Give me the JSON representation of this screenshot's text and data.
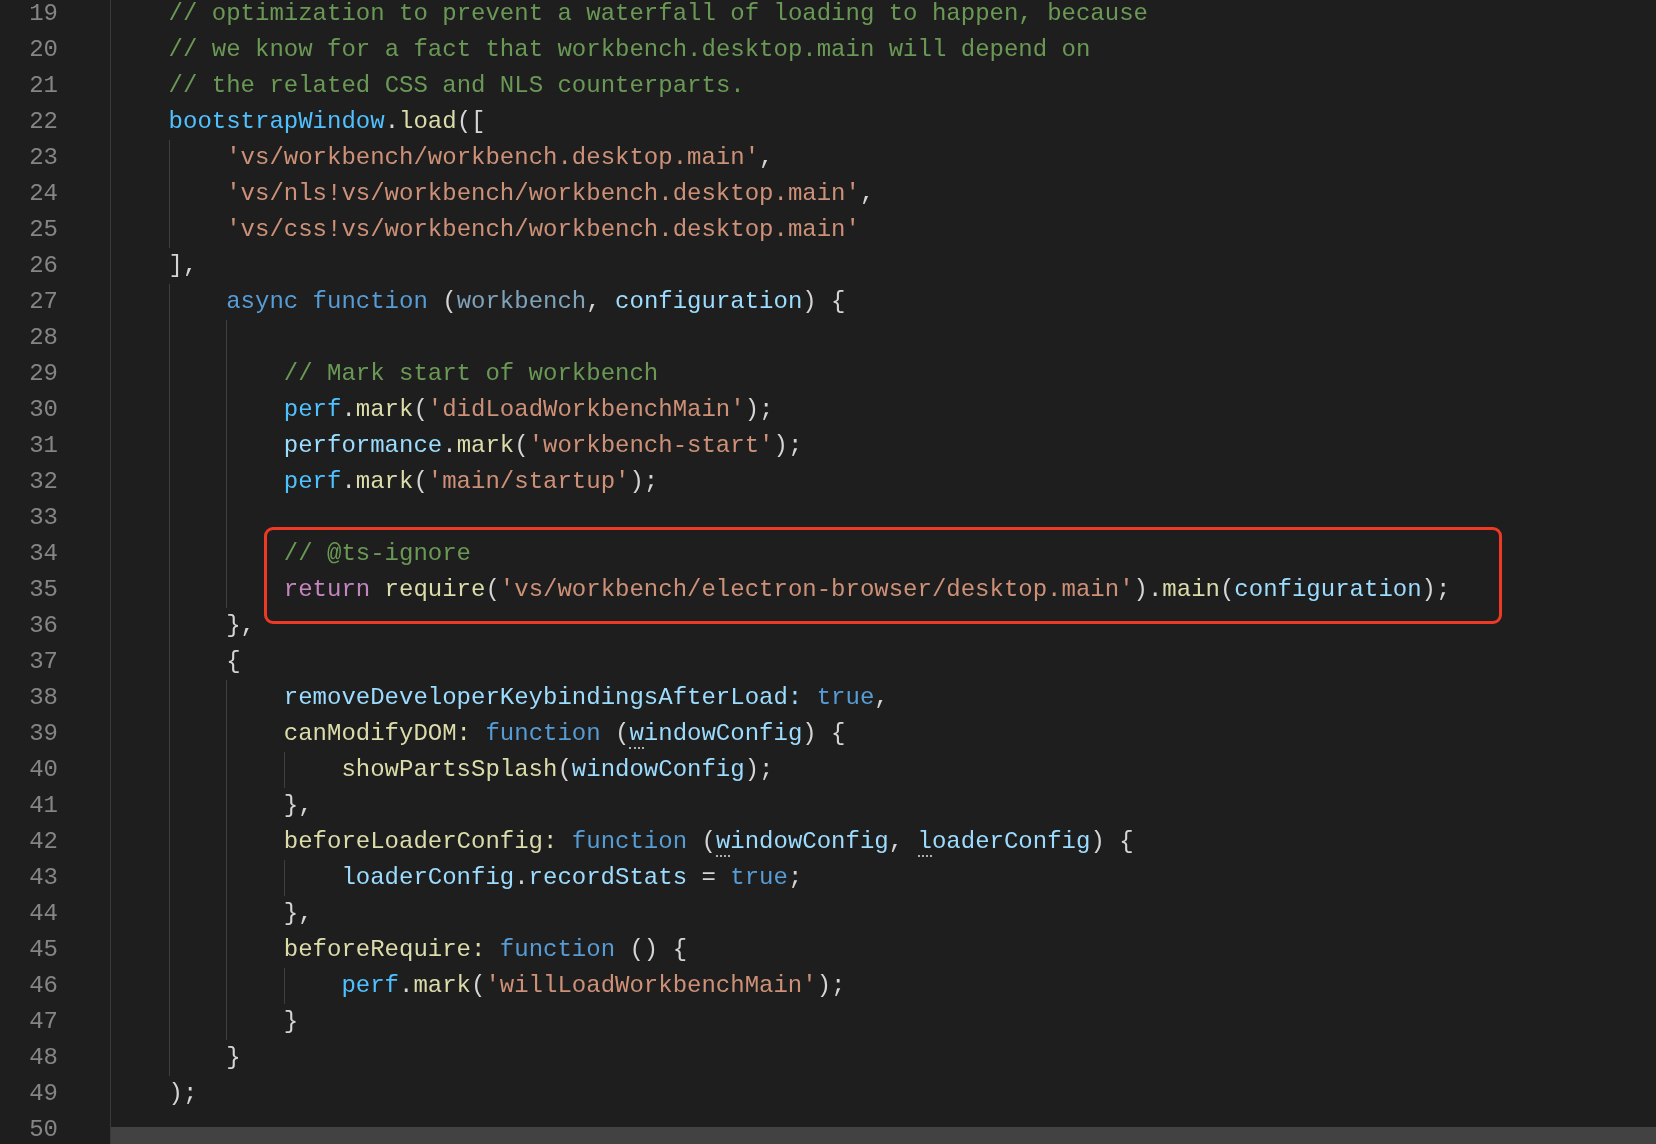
{
  "editor": {
    "lines": [
      {
        "number": "19",
        "tokens": [
          {
            "text": "// optimization to prevent a waterfall of loading to happen, because",
            "kind": "comment"
          }
        ]
      },
      {
        "number": "20",
        "tokens": [
          {
            "text": "// we know for a fact that workbench.desktop.main will depend on",
            "kind": "comment"
          }
        ]
      },
      {
        "number": "21",
        "tokens": [
          {
            "text": "// the related CSS and NLS counterparts.",
            "kind": "comment"
          }
        ]
      },
      {
        "number": "22",
        "tokens": [
          {
            "text": "bootstrapWindow",
            "kind": "variable"
          },
          {
            "text": ".",
            "kind": "punct"
          },
          {
            "text": "load",
            "kind": "function"
          },
          {
            "text": "([",
            "kind": "punct"
          }
        ],
        "children": [
          {
            "number": "23",
            "tokens": [
              {
                "text": "'vs/workbench/workbench.desktop.main'",
                "kind": "string"
              },
              {
                "text": ",",
                "kind": "punct"
              }
            ]
          },
          {
            "number": "24",
            "tokens": [
              {
                "text": "'vs/nls!vs/workbench/workbench.desktop.main'",
                "kind": "string"
              },
              {
                "text": ",",
                "kind": "punct"
              }
            ]
          },
          {
            "number": "25",
            "tokens": [
              {
                "text": "'vs/css!vs/workbench/workbench.desktop.main'",
                "kind": "string"
              }
            ]
          }
        ]
      },
      {
        "number": "26",
        "tokens": [
          {
            "text": "],",
            "kind": "punct"
          }
        ],
        "children": [
          {
            "number": "27",
            "tokens": [
              {
                "text": "async",
                "kind": "keyword"
              },
              {
                "text": " function",
                "kind": "keyword"
              },
              {
                "text": " (",
                "kind": "punct"
              },
              {
                "text": "workbench",
                "kind": "unused"
              },
              {
                "text": ",",
                "kind": "punct"
              },
              {
                "text": " configuration",
                "kind": "property"
              },
              {
                "text": ") {",
                "kind": "punct"
              }
            ],
            "children": [
              {
                "number": "28"
              },
              {
                "number": "29",
                "tokens": [
                  {
                    "text": "// Mark start of workbench",
                    "kind": "comment"
                  }
                ]
              },
              {
                "number": "30",
                "tokens": [
                  {
                    "text": "perf",
                    "kind": "variable"
                  },
                  {
                    "text": ".",
                    "kind": "punct"
                  },
                  {
                    "text": "mark",
                    "kind": "function"
                  },
                  {
                    "text": "(",
                    "kind": "punct"
                  },
                  {
                    "text": "'didLoadWorkbenchMain'",
                    "kind": "string"
                  },
                  {
                    "text": ");",
                    "kind": "punct"
                  }
                ]
              },
              {
                "number": "31",
                "tokens": [
                  {
                    "text": "performance",
                    "kind": "property"
                  },
                  {
                    "text": ".",
                    "kind": "punct"
                  },
                  {
                    "text": "mark",
                    "kind": "function"
                  },
                  {
                    "text": "(",
                    "kind": "punct"
                  },
                  {
                    "text": "'workbench-start'",
                    "kind": "string"
                  },
                  {
                    "text": ");",
                    "kind": "punct"
                  }
                ]
              },
              {
                "number": "32",
                "tokens": [
                  {
                    "text": "perf",
                    "kind": "variable"
                  },
                  {
                    "text": ".",
                    "kind": "punct"
                  },
                  {
                    "text": "mark",
                    "kind": "function"
                  },
                  {
                    "text": "(",
                    "kind": "punct"
                  },
                  {
                    "text": "'main/startup'",
                    "kind": "string"
                  },
                  {
                    "text": ");",
                    "kind": "punct"
                  }
                ]
              },
              {
                "number": "33"
              },
              {
                "number": "34",
                "boxed": true,
                "tokens": [
                  {
                    "text": "// @ts-ignore",
                    "kind": "comment"
                  }
                ]
              },
              {
                "number": "35",
                "boxed": true,
                "tokens": [
                  {
                    "text": "return",
                    "kind": "control"
                  },
                  {
                    "text": " require",
                    "kind": "function"
                  },
                  {
                    "text": "(",
                    "kind": "punct"
                  },
                  {
                    "text": "'vs/workbench/electron-browser/desktop.main'",
                    "kind": "string"
                  },
                  {
                    "text": ").",
                    "kind": "punct"
                  },
                  {
                    "text": "main",
                    "kind": "function"
                  },
                  {
                    "text": "(",
                    "kind": "punct"
                  },
                  {
                    "text": "configuration",
                    "kind": "property"
                  },
                  {
                    "text": ");",
                    "kind": "punct"
                  }
                ]
              }
            ]
          },
          {
            "number": "36",
            "tokens": [
              {
                "text": "},",
                "kind": "punct"
              }
            ]
          },
          {
            "number": "37",
            "tokens": [
              {
                "text": "{",
                "kind": "punct"
              }
            ],
            "children": [
              {
                "number": "38",
                "tokens": [
                  {
                    "text": "removeDeveloperKeybindingsAfterLoad:",
                    "kind": "property"
                  },
                  {
                    "text": " true",
                    "kind": "keyword"
                  },
                  {
                    "text": ",",
                    "kind": "punct"
                  }
                ]
              },
              {
                "number": "39",
                "tokens": [
                  {
                    "text": "canModifyDOM:",
                    "kind": "function"
                  },
                  {
                    "text": " function",
                    "kind": "keyword"
                  },
                  {
                    "text": " (",
                    "kind": "punct"
                  },
                  {
                    "text": "windowConfig",
                    "kind": "property",
                    "hint": true
                  },
                  {
                    "text": ") {",
                    "kind": "punct"
                  }
                ],
                "children": [
                  {
                    "number": "40",
                    "tokens": [
                      {
                        "text": "showPartsSplash",
                        "kind": "function"
                      },
                      {
                        "text": "(",
                        "kind": "punct"
                      },
                      {
                        "text": "windowConfig",
                        "kind": "property"
                      },
                      {
                        "text": ");",
                        "kind": "punct"
                      }
                    ]
                  }
                ]
              },
              {
                "number": "41",
                "tokens": [
                  {
                    "text": "},",
                    "kind": "punct"
                  }
                ]
              },
              {
                "number": "42",
                "tokens": [
                  {
                    "text": "beforeLoaderConfig:",
                    "kind": "function"
                  },
                  {
                    "text": " function",
                    "kind": "keyword"
                  },
                  {
                    "text": " (",
                    "kind": "punct"
                  },
                  {
                    "text": "windowConfig",
                    "kind": "property",
                    "hint": true
                  },
                  {
                    "text": ",",
                    "kind": "punct"
                  },
                  {
                    "text": " loaderConfig",
                    "kind": "property",
                    "hint": true
                  },
                  {
                    "text": ") {",
                    "kind": "punct"
                  }
                ],
                "children": [
                  {
                    "number": "43",
                    "tokens": [
                      {
                        "text": "loaderConfig",
                        "kind": "property"
                      },
                      {
                        "text": ".",
                        "kind": "punct"
                      },
                      {
                        "text": "recordStats",
                        "kind": "property"
                      },
                      {
                        "text": " =",
                        "kind": "punct"
                      },
                      {
                        "text": " true",
                        "kind": "keyword"
                      },
                      {
                        "text": ";",
                        "kind": "punct"
                      }
                    ]
                  }
                ]
              },
              {
                "number": "44",
                "tokens": [
                  {
                    "text": "},",
                    "kind": "punct"
                  }
                ]
              },
              {
                "number": "45",
                "tokens": [
                  {
                    "text": "beforeRequire:",
                    "kind": "function"
                  },
                  {
                    "text": " function",
                    "kind": "keyword"
                  },
                  {
                    "text": " () {",
                    "kind": "punct"
                  }
                ],
                "children": [
                  {
                    "number": "46",
                    "tokens": [
                      {
                        "text": "perf",
                        "kind": "variable"
                      },
                      {
                        "text": ".",
                        "kind": "punct"
                      },
                      {
                        "text": "mark",
                        "kind": "function"
                      },
                      {
                        "text": "(",
                        "kind": "punct"
                      },
                      {
                        "text": "'willLoadWorkbenchMain'",
                        "kind": "string"
                      },
                      {
                        "text": ");",
                        "kind": "punct"
                      }
                    ]
                  }
                ]
              },
              {
                "number": "47",
                "tokens": [
                  {
                    "text": "}",
                    "kind": "punct"
                  }
                ]
              }
            ]
          },
          {
            "number": "48",
            "tokens": [
              {
                "text": "}",
                "kind": "punct"
              }
            ]
          }
        ]
      },
      {
        "number": "49",
        "tokens": [
          {
            "text": ");",
            "kind": "punct"
          }
        ]
      },
      {
        "number": "50"
      }
    ]
  }
}
